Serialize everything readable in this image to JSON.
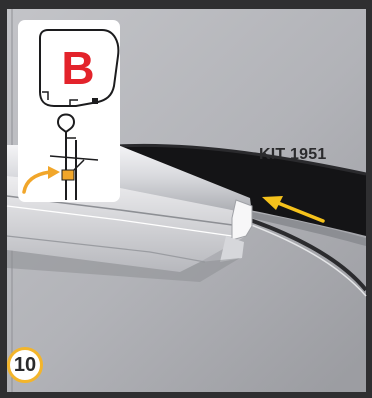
{
  "inset": {
    "letter": "B",
    "letter_color": "#e3232b",
    "arrow_color": "#f1a62a",
    "latch_color": "#f1a62a"
  },
  "photo": {
    "kit_label": "KIT 1951",
    "arrow_color": "#f5c21c",
    "frame_color": "#2f2f31"
  },
  "step": {
    "number": "10",
    "ring_color": "#f3b52b"
  }
}
